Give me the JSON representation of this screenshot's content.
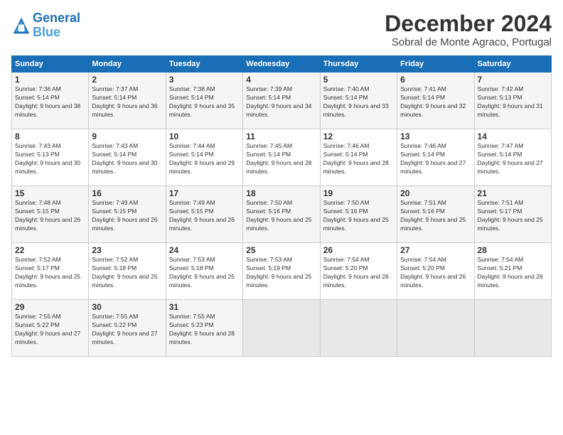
{
  "logo": {
    "line1": "General",
    "line2": "Blue"
  },
  "title": "December 2024",
  "subtitle": "Sobral de Monte Agraco, Portugal",
  "days_header": [
    "Sunday",
    "Monday",
    "Tuesday",
    "Wednesday",
    "Thursday",
    "Friday",
    "Saturday"
  ],
  "weeks": [
    [
      {
        "day": "1",
        "sunrise": "7:36 AM",
        "sunset": "5:14 PM",
        "daylight": "9 hours and 38 minutes."
      },
      {
        "day": "2",
        "sunrise": "7:37 AM",
        "sunset": "5:14 PM",
        "daylight": "9 hours and 36 minutes."
      },
      {
        "day": "3",
        "sunrise": "7:38 AM",
        "sunset": "5:14 PM",
        "daylight": "9 hours and 35 minutes."
      },
      {
        "day": "4",
        "sunrise": "7:39 AM",
        "sunset": "5:14 PM",
        "daylight": "9 hours and 34 minutes."
      },
      {
        "day": "5",
        "sunrise": "7:40 AM",
        "sunset": "5:14 PM",
        "daylight": "9 hours and 33 minutes."
      },
      {
        "day": "6",
        "sunrise": "7:41 AM",
        "sunset": "5:14 PM",
        "daylight": "9 hours and 32 minutes."
      },
      {
        "day": "7",
        "sunrise": "7:42 AM",
        "sunset": "5:13 PM",
        "daylight": "9 hours and 31 minutes."
      }
    ],
    [
      {
        "day": "8",
        "sunrise": "7:43 AM",
        "sunset": "5:13 PM",
        "daylight": "9 hours and 30 minutes."
      },
      {
        "day": "9",
        "sunrise": "7:43 AM",
        "sunset": "5:14 PM",
        "daylight": "9 hours and 30 minutes."
      },
      {
        "day": "10",
        "sunrise": "7:44 AM",
        "sunset": "5:14 PM",
        "daylight": "9 hours and 29 minutes."
      },
      {
        "day": "11",
        "sunrise": "7:45 AM",
        "sunset": "5:14 PM",
        "daylight": "9 hours and 28 minutes."
      },
      {
        "day": "12",
        "sunrise": "7:46 AM",
        "sunset": "5:14 PM",
        "daylight": "9 hours and 28 minutes."
      },
      {
        "day": "13",
        "sunrise": "7:46 AM",
        "sunset": "5:14 PM",
        "daylight": "9 hours and 27 minutes."
      },
      {
        "day": "14",
        "sunrise": "7:47 AM",
        "sunset": "5:14 PM",
        "daylight": "9 hours and 27 minutes."
      }
    ],
    [
      {
        "day": "15",
        "sunrise": "7:48 AM",
        "sunset": "5:15 PM",
        "daylight": "9 hours and 26 minutes."
      },
      {
        "day": "16",
        "sunrise": "7:49 AM",
        "sunset": "5:15 PM",
        "daylight": "9 hours and 26 minutes."
      },
      {
        "day": "17",
        "sunrise": "7:49 AM",
        "sunset": "5:15 PM",
        "daylight": "9 hours and 26 minutes."
      },
      {
        "day": "18",
        "sunrise": "7:50 AM",
        "sunset": "5:16 PM",
        "daylight": "9 hours and 25 minutes."
      },
      {
        "day": "19",
        "sunrise": "7:50 AM",
        "sunset": "5:16 PM",
        "daylight": "9 hours and 25 minutes."
      },
      {
        "day": "20",
        "sunrise": "7:51 AM",
        "sunset": "5:16 PM",
        "daylight": "9 hours and 25 minutes."
      },
      {
        "day": "21",
        "sunrise": "7:51 AM",
        "sunset": "5:17 PM",
        "daylight": "9 hours and 25 minutes."
      }
    ],
    [
      {
        "day": "22",
        "sunrise": "7:52 AM",
        "sunset": "5:17 PM",
        "daylight": "9 hours and 25 minutes."
      },
      {
        "day": "23",
        "sunrise": "7:52 AM",
        "sunset": "5:18 PM",
        "daylight": "9 hours and 25 minutes."
      },
      {
        "day": "24",
        "sunrise": "7:53 AM",
        "sunset": "5:18 PM",
        "daylight": "9 hours and 25 minutes."
      },
      {
        "day": "25",
        "sunrise": "7:53 AM",
        "sunset": "5:19 PM",
        "daylight": "9 hours and 25 minutes."
      },
      {
        "day": "26",
        "sunrise": "7:54 AM",
        "sunset": "5:20 PM",
        "daylight": "9 hours and 26 minutes."
      },
      {
        "day": "27",
        "sunrise": "7:54 AM",
        "sunset": "5:20 PM",
        "daylight": "9 hours and 26 minutes."
      },
      {
        "day": "28",
        "sunrise": "7:54 AM",
        "sunset": "5:21 PM",
        "daylight": "9 hours and 26 minutes."
      }
    ],
    [
      {
        "day": "29",
        "sunrise": "7:55 AM",
        "sunset": "5:22 PM",
        "daylight": "9 hours and 27 minutes."
      },
      {
        "day": "30",
        "sunrise": "7:55 AM",
        "sunset": "5:22 PM",
        "daylight": "9 hours and 27 minutes."
      },
      {
        "day": "31",
        "sunrise": "7:55 AM",
        "sunset": "5:23 PM",
        "daylight": "9 hours and 28 minutes."
      },
      null,
      null,
      null,
      null
    ]
  ]
}
